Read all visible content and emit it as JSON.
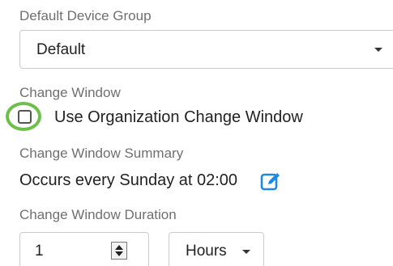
{
  "device_group": {
    "label": "Default Device Group",
    "selected": "Default"
  },
  "change_window": {
    "label": "Change Window",
    "checkbox_label": "Use Organization Change Window",
    "checked": false
  },
  "summary": {
    "label": "Change Window Summary",
    "text": "Occurs every Sunday at 02:00"
  },
  "duration": {
    "label": "Change Window Duration",
    "value": "1",
    "unit": "Hours"
  },
  "colors": {
    "highlight_ring": "#6cc04a",
    "edit_icon": "#1e88e5",
    "label_gray": "#6f6f6f"
  },
  "icons": {
    "edit": "edit-icon",
    "dropdown": "chevron-down-icon",
    "spinner": "spinner-icon"
  }
}
